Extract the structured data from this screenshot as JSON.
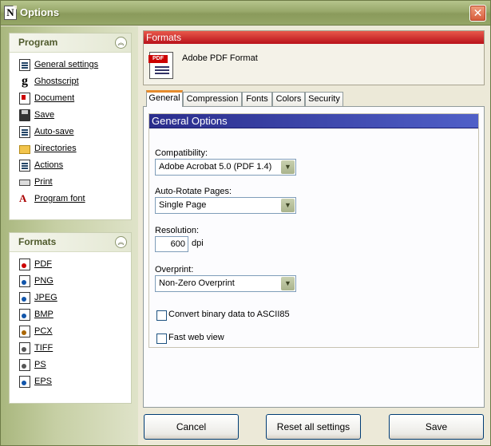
{
  "window": {
    "title": "Options",
    "title_icon": "N",
    "close_glyph": "✕"
  },
  "program_panel": {
    "title": "Program",
    "items": [
      {
        "label": "General settings",
        "icon": "document-icon"
      },
      {
        "label": "Ghostscript",
        "icon": "ghostscript-icon"
      },
      {
        "label": "Document",
        "icon": "document-red-icon"
      },
      {
        "label": "Save",
        "icon": "floppy-icon"
      },
      {
        "label": "Auto-save",
        "icon": "autosave-icon"
      },
      {
        "label": "Directories",
        "icon": "folder-icon"
      },
      {
        "label": "Actions",
        "icon": "actions-icon"
      },
      {
        "label": "Print",
        "icon": "printer-icon"
      },
      {
        "label": "Program font",
        "icon": "font-icon"
      }
    ]
  },
  "formats_panel": {
    "title": "Formats",
    "items": [
      "PDF",
      "PNG",
      "JPEG",
      "BMP",
      "PCX",
      "TIFF",
      "PS",
      "EPS"
    ]
  },
  "formats_box": {
    "title": "Formats",
    "format_name": "Adobe PDF Format",
    "icon_tag": "PDF"
  },
  "tabs": [
    "General",
    "Compression",
    "Fonts",
    "Colors",
    "Security"
  ],
  "general": {
    "title": "General Options",
    "compatibility_label": "Compatibility:",
    "compatibility_value": "Adobe Acrobat 5.0 (PDF 1.4)",
    "autorotate_label": "Auto-Rotate Pages:",
    "autorotate_value": "Single Page",
    "resolution_label": "Resolution:",
    "resolution_value": "600",
    "resolution_unit": "dpi",
    "overprint_label": "Overprint:",
    "overprint_value": "Non-Zero Overprint",
    "ascii85_label": "Convert binary data to ASCII85",
    "fastweb_label": "Fast web view",
    "collapse_glyph": "︽",
    "arrow_glyph": "▼"
  },
  "buttons": {
    "cancel": "Cancel",
    "reset": "Reset all settings",
    "save": "Save"
  }
}
